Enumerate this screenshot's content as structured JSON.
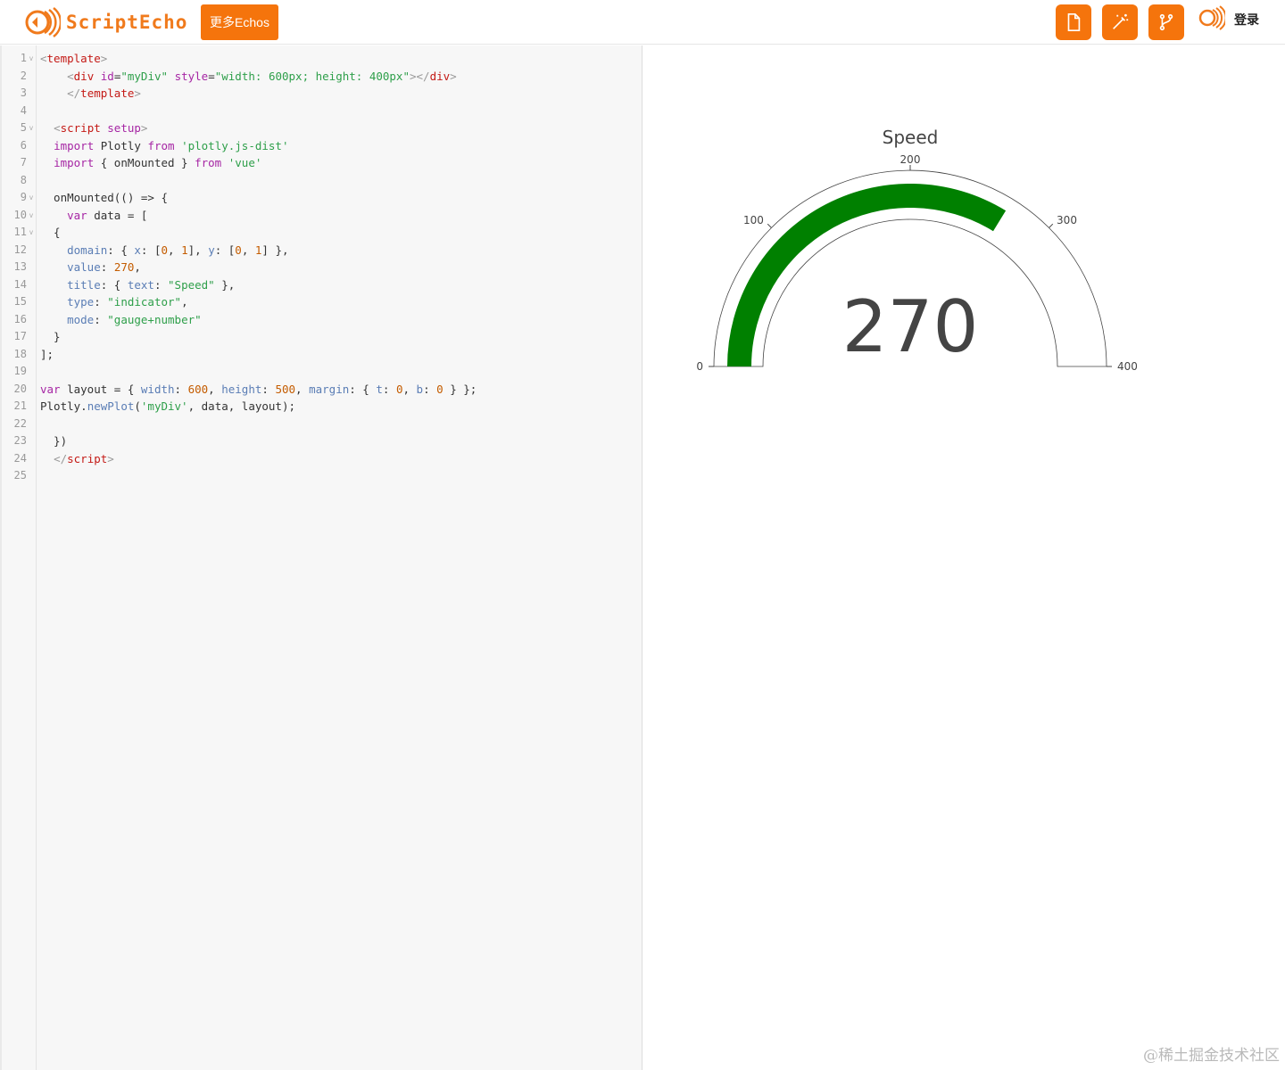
{
  "header": {
    "logo_text": "ScriptEcho",
    "more_button": "更多Echos",
    "tools": [
      {
        "name": "new-file",
        "icon": "file-icon"
      },
      {
        "name": "magic",
        "icon": "magic-wand-icon"
      },
      {
        "name": "fork",
        "icon": "fork-icon"
      }
    ],
    "login": "登录"
  },
  "editor": {
    "line_count": 25,
    "fold_lines": [
      1,
      5,
      9,
      10,
      11
    ],
    "lines": [
      [
        [
          "br",
          "<"
        ],
        [
          "tag",
          "template"
        ],
        [
          "br",
          ">"
        ]
      ],
      [
        [
          "plain",
          "    "
        ],
        [
          "br",
          "<"
        ],
        [
          "tag",
          "div"
        ],
        [
          "plain",
          " "
        ],
        [
          "attr",
          "id"
        ],
        [
          "plain",
          "="
        ],
        [
          "str",
          "\"myDiv\""
        ],
        [
          "plain",
          " "
        ],
        [
          "attr",
          "style"
        ],
        [
          "plain",
          "="
        ],
        [
          "str",
          "\"width: 600px; height: 400px\""
        ],
        [
          "br",
          "></"
        ],
        [
          "tag",
          "div"
        ],
        [
          "br",
          ">"
        ]
      ],
      [
        [
          "plain",
          "    "
        ],
        [
          "br",
          "</"
        ],
        [
          "tag",
          "template"
        ],
        [
          "br",
          ">"
        ]
      ],
      [],
      [
        [
          "plain",
          "  "
        ],
        [
          "br",
          "<"
        ],
        [
          "tag",
          "script"
        ],
        [
          "plain",
          " "
        ],
        [
          "attr",
          "setup"
        ],
        [
          "br",
          ">"
        ]
      ],
      [
        [
          "plain",
          "  "
        ],
        [
          "kw",
          "import"
        ],
        [
          "plain",
          " Plotly "
        ],
        [
          "kw",
          "from"
        ],
        [
          "plain",
          " "
        ],
        [
          "str",
          "'plotly.js-dist'"
        ]
      ],
      [
        [
          "plain",
          "  "
        ],
        [
          "kw",
          "import"
        ],
        [
          "plain",
          " { onMounted } "
        ],
        [
          "kw",
          "from"
        ],
        [
          "plain",
          " "
        ],
        [
          "str",
          "'vue'"
        ]
      ],
      [],
      [
        [
          "plain",
          "  onMounted(() => {"
        ]
      ],
      [
        [
          "plain",
          "    "
        ],
        [
          "kw",
          "var"
        ],
        [
          "plain",
          " data = ["
        ]
      ],
      [
        [
          "plain",
          "  {"
        ]
      ],
      [
        [
          "plain",
          "    "
        ],
        [
          "prop",
          "domain"
        ],
        [
          "plain",
          ": { "
        ],
        [
          "prop",
          "x"
        ],
        [
          "plain",
          ": ["
        ],
        [
          "num",
          "0"
        ],
        [
          "plain",
          ", "
        ],
        [
          "num",
          "1"
        ],
        [
          "plain",
          "], "
        ],
        [
          "prop",
          "y"
        ],
        [
          "plain",
          ": ["
        ],
        [
          "num",
          "0"
        ],
        [
          "plain",
          ", "
        ],
        [
          "num",
          "1"
        ],
        [
          "plain",
          "] },"
        ]
      ],
      [
        [
          "plain",
          "    "
        ],
        [
          "prop",
          "value"
        ],
        [
          "plain",
          ": "
        ],
        [
          "num",
          "270"
        ],
        [
          "plain",
          ","
        ]
      ],
      [
        [
          "plain",
          "    "
        ],
        [
          "prop",
          "title"
        ],
        [
          "plain",
          ": { "
        ],
        [
          "prop",
          "text"
        ],
        [
          "plain",
          ": "
        ],
        [
          "str",
          "\"Speed\""
        ],
        [
          "plain",
          " },"
        ]
      ],
      [
        [
          "plain",
          "    "
        ],
        [
          "prop",
          "type"
        ],
        [
          "plain",
          ": "
        ],
        [
          "str",
          "\"indicator\""
        ],
        [
          "plain",
          ","
        ]
      ],
      [
        [
          "plain",
          "    "
        ],
        [
          "prop",
          "mode"
        ],
        [
          "plain",
          ": "
        ],
        [
          "str",
          "\"gauge+number\""
        ]
      ],
      [
        [
          "plain",
          "  }"
        ]
      ],
      [
        [
          "plain",
          "];"
        ]
      ],
      [],
      [
        [
          "kw",
          "var"
        ],
        [
          "plain",
          " layout = { "
        ],
        [
          "prop",
          "width"
        ],
        [
          "plain",
          ": "
        ],
        [
          "num",
          "600"
        ],
        [
          "plain",
          ", "
        ],
        [
          "prop",
          "height"
        ],
        [
          "plain",
          ": "
        ],
        [
          "num",
          "500"
        ],
        [
          "plain",
          ", "
        ],
        [
          "prop",
          "margin"
        ],
        [
          "plain",
          ": { "
        ],
        [
          "prop",
          "t"
        ],
        [
          "plain",
          ": "
        ],
        [
          "num",
          "0"
        ],
        [
          "plain",
          ", "
        ],
        [
          "prop",
          "b"
        ],
        [
          "plain",
          ": "
        ],
        [
          "num",
          "0"
        ],
        [
          "plain",
          " } };"
        ]
      ],
      [
        [
          "plain",
          "Plotly."
        ],
        [
          "prop",
          "newPlot"
        ],
        [
          "plain",
          "("
        ],
        [
          "str",
          "'myDiv'"
        ],
        [
          "plain",
          ", data, layout);"
        ]
      ],
      [],
      [
        [
          "plain",
          "  })"
        ]
      ],
      [
        [
          "plain",
          "  "
        ],
        [
          "br",
          "</"
        ],
        [
          "tag",
          "script"
        ],
        [
          "br",
          ">"
        ]
      ],
      []
    ]
  },
  "chart_data": {
    "type": "gauge",
    "title": "Speed",
    "value": 270,
    "display_value": "270",
    "range": [
      0,
      400
    ],
    "ticks": [
      0,
      100,
      200,
      300,
      400
    ],
    "tick_labels": [
      "0",
      "100",
      "200",
      "300",
      "400"
    ],
    "bar_color": "#008000",
    "text_color": "#444444"
  },
  "watermark": "@稀土掘金技术社区"
}
